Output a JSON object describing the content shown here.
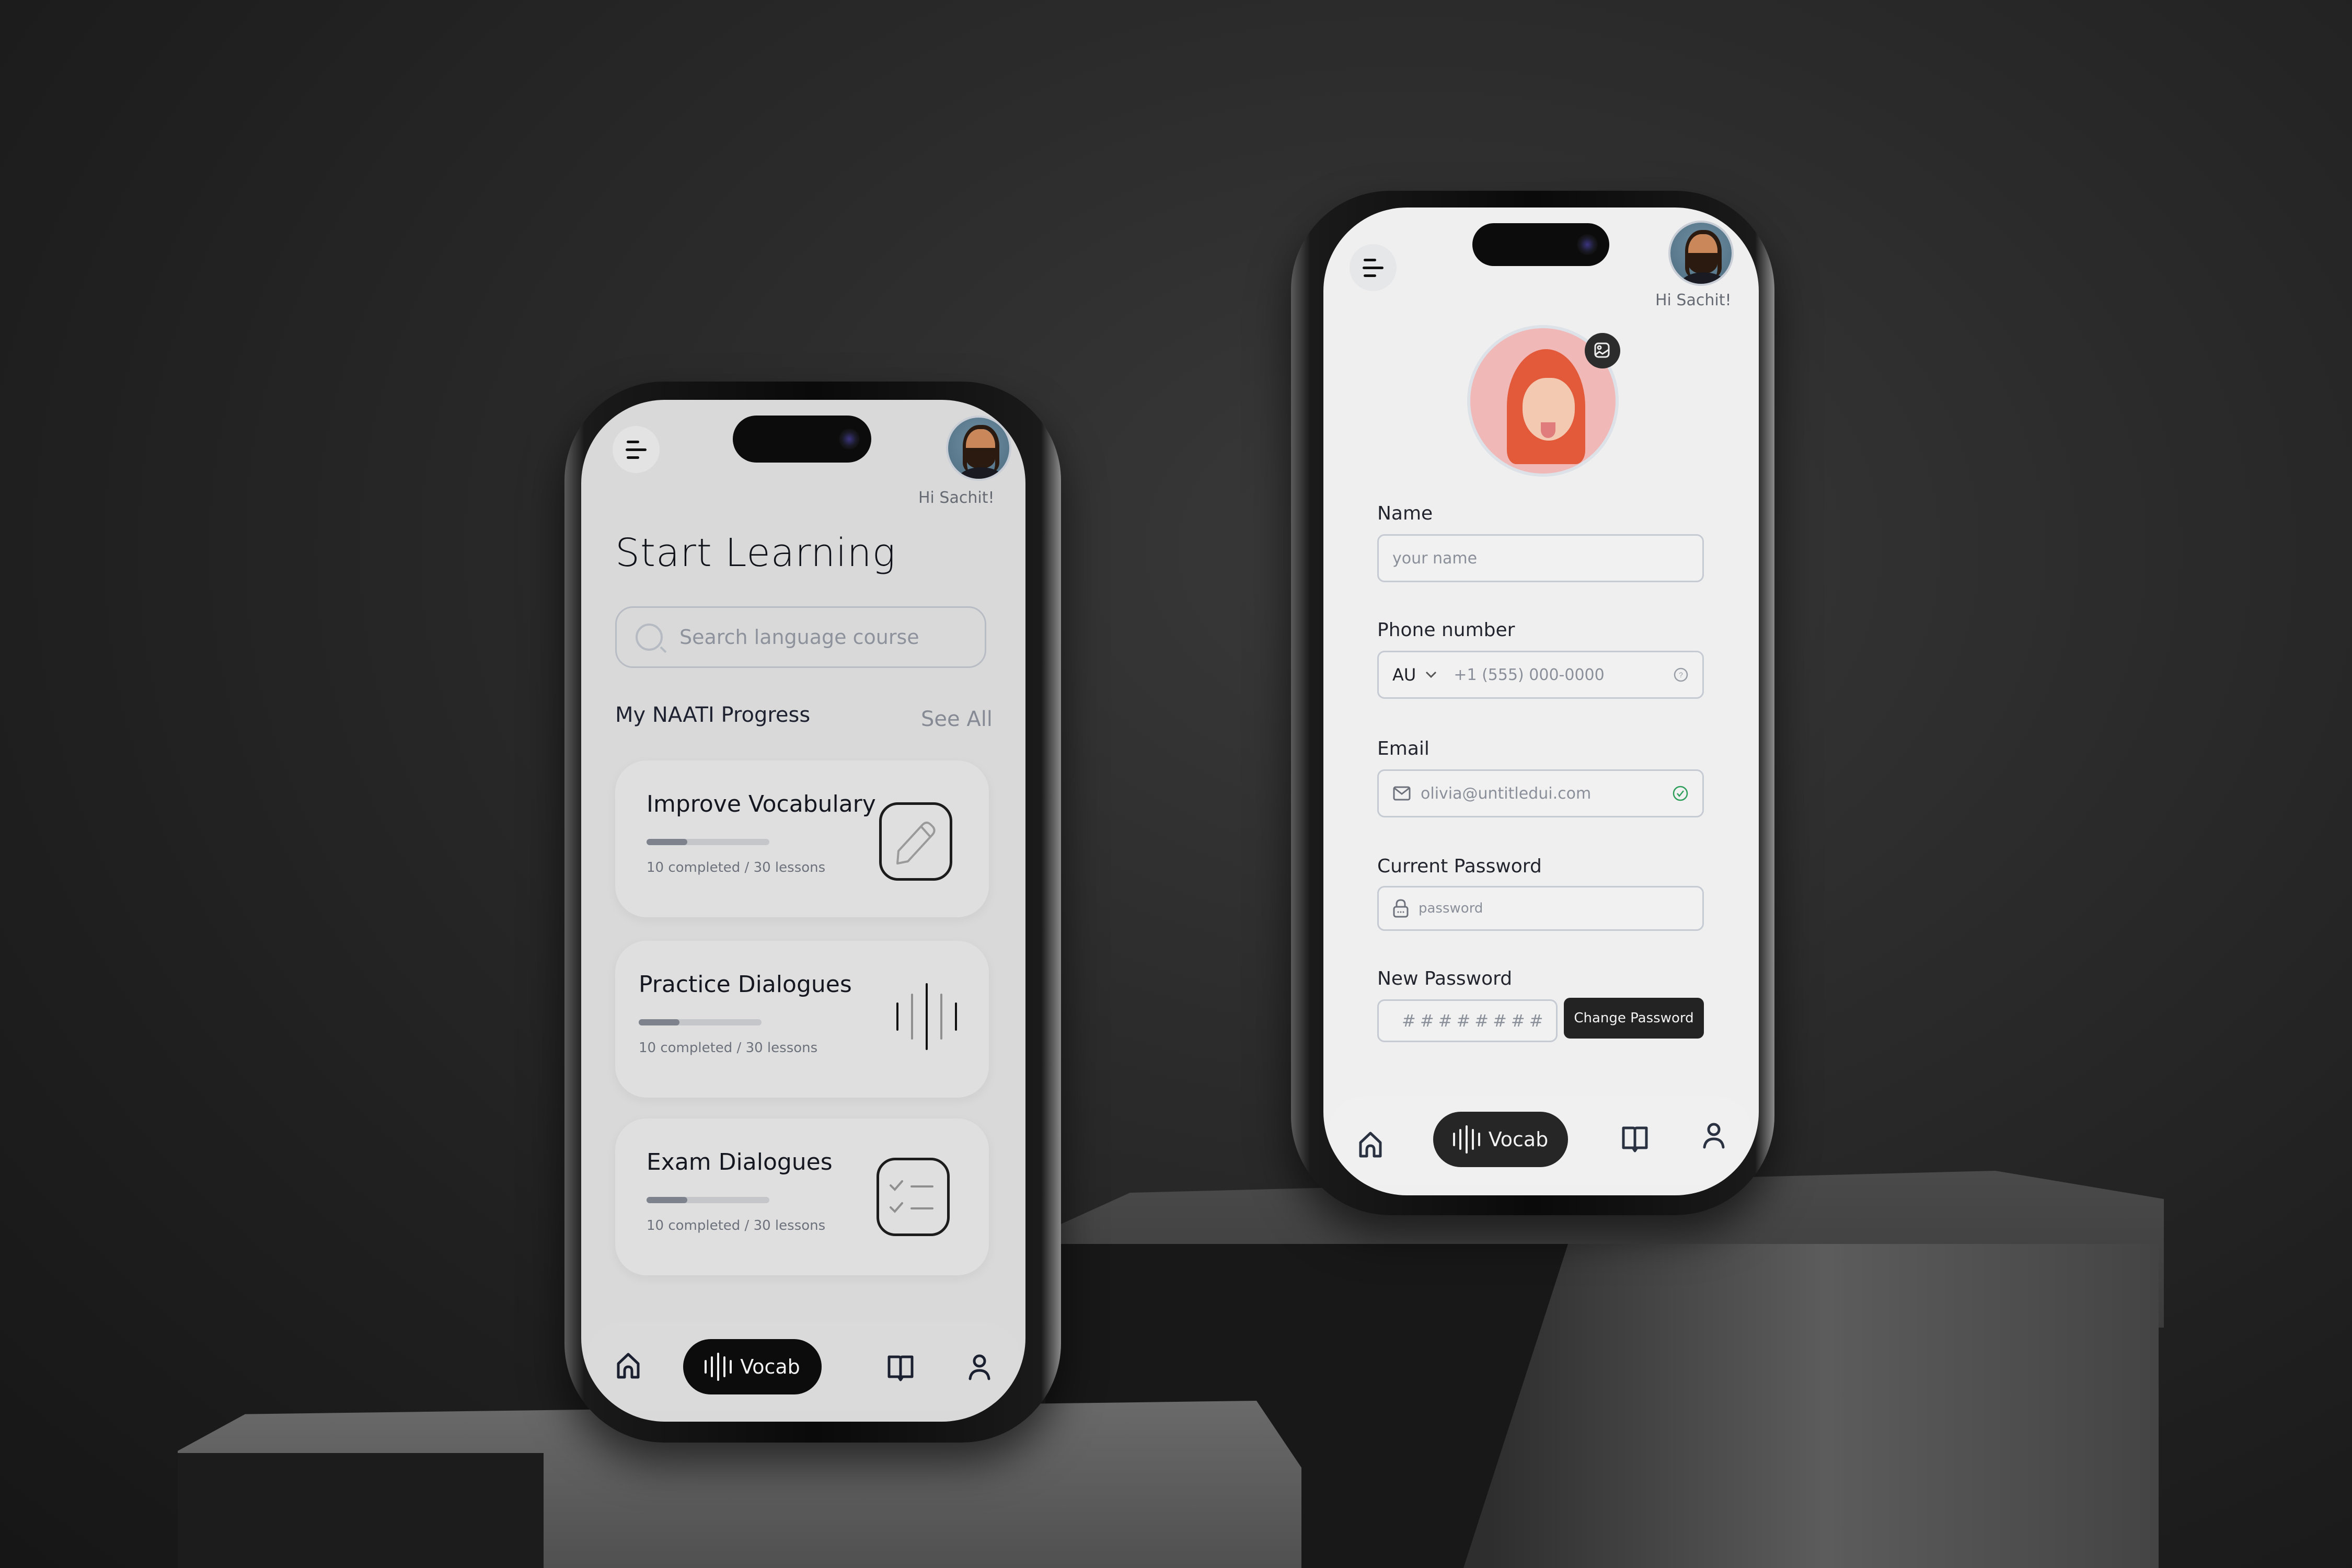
{
  "scene": {
    "background_color": "#2c2c2c"
  },
  "left_phone": {
    "greeting": "Hi Sachit!",
    "title": "Start Learning",
    "search": {
      "placeholder": "Search language course"
    },
    "progress_section": {
      "title": "My NAATI Progress",
      "see_all_label": "See All"
    },
    "cards": [
      {
        "title": "Improve Vocabulary",
        "completed": 10,
        "total": 30,
        "progress": 0.33,
        "meta": "10 completed / 30 lessons",
        "icon": "pencil-icon"
      },
      {
        "title": "Practice Dialogues",
        "completed": 10,
        "total": 30,
        "progress": 0.33,
        "meta": "10 completed / 30 lessons",
        "icon": "sound-wave-icon"
      },
      {
        "title": "Exam Dialogues",
        "completed": 10,
        "total": 30,
        "progress": 0.33,
        "meta": "10 completed / 30 lessons",
        "icon": "checklist-icon"
      }
    ],
    "nav": {
      "items": [
        {
          "name": "home",
          "icon": "home-icon"
        },
        {
          "name": "vocab",
          "label": "Vocab",
          "icon": "sound-wave-icon",
          "active": true
        },
        {
          "name": "library",
          "icon": "book-icon"
        },
        {
          "name": "profile",
          "icon": "user-icon"
        }
      ]
    }
  },
  "right_phone": {
    "greeting": "Hi Sachit!",
    "profile_edit_icon": "image-edit-icon",
    "form": {
      "name": {
        "label": "Name",
        "placeholder": "your name"
      },
      "phone": {
        "label": "Phone number",
        "country": "AU",
        "placeholder": "+1 (555) 000-0000",
        "help_icon": "help-circle-icon"
      },
      "email": {
        "label": "Email",
        "value": "olivia@untitledui.com",
        "status_icon": "check-circle-icon",
        "status_color": "#2e9e5b"
      },
      "current_password": {
        "label": "Current Password",
        "placeholder": "password"
      },
      "new_password": {
        "label": "New Password",
        "value": "########",
        "button_label": "Change Password"
      }
    },
    "nav": {
      "items": [
        {
          "name": "home",
          "icon": "home-icon"
        },
        {
          "name": "vocab",
          "label": "Vocab",
          "icon": "sound-wave-icon",
          "active": true
        },
        {
          "name": "library",
          "icon": "book-icon"
        },
        {
          "name": "profile",
          "icon": "user-icon"
        }
      ]
    }
  }
}
